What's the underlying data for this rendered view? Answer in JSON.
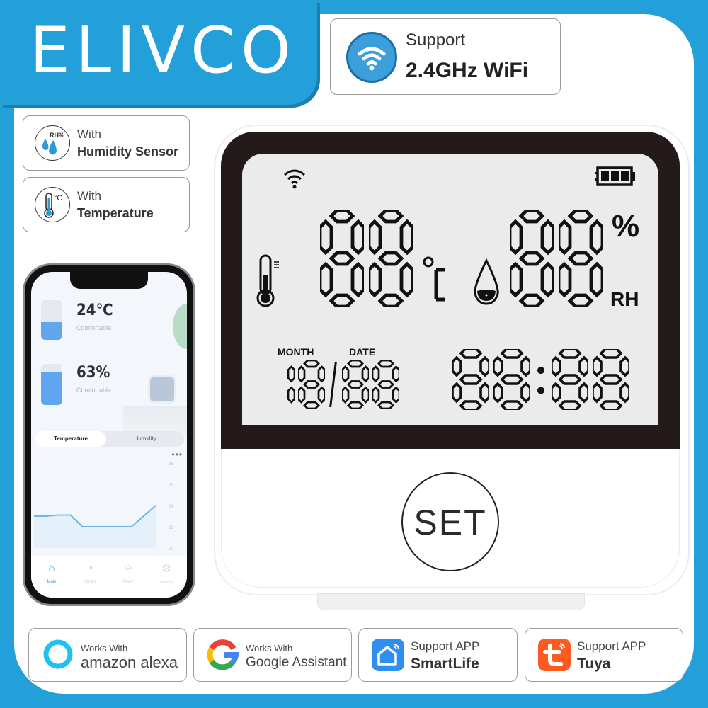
{
  "brand": {
    "logo_text": "ELIVCO",
    "accent_color": "#239fd9"
  },
  "wifi_badge": {
    "line1": "Support",
    "line2": "2.4GHz WiFi",
    "icon": "wifi-icon",
    "icon_color": "#3a9fdb"
  },
  "features": [
    {
      "icon": "humidity-drops-icon",
      "icon_text": "RH%",
      "line1": "With",
      "line2": "Humidity Sensor"
    },
    {
      "icon": "thermometer-icon",
      "icon_text": "℃",
      "line1": "With",
      "line2": "Temperature"
    }
  ],
  "phone_app": {
    "temperature": {
      "value": "24℃",
      "status": "Comfortable",
      "gauge_fill": 0.45
    },
    "humidity": {
      "value": "63%",
      "status": "Comfortable",
      "gauge_fill": 0.8
    },
    "tabs": [
      {
        "label": "Temperature",
        "active": true
      },
      {
        "label": "Humidity",
        "active": false
      }
    ],
    "more_label": "•••",
    "chart_data": {
      "type": "area",
      "title": "",
      "xlabel": "",
      "ylabel": "",
      "y_ticks": [
        "28",
        "26",
        "24",
        "22",
        "20"
      ],
      "ylim": [
        20,
        28
      ],
      "x": [
        0,
        1,
        2,
        3,
        4,
        5,
        6,
        7,
        8,
        9,
        10
      ],
      "values": [
        23.0,
        23.0,
        23.1,
        23.1,
        22.0,
        22.0,
        22.0,
        22.0,
        22.0,
        23.0,
        24.0
      ],
      "grid": false,
      "line_color": "#5ab0e0"
    },
    "nav": [
      {
        "label": "Main",
        "icon": "home-icon",
        "glyph": "⌂",
        "active": true
      },
      {
        "label": "Smart",
        "icon": "clock-icon",
        "glyph": "◔",
        "active": false
      },
      {
        "label": "Alarm",
        "icon": "bell-icon",
        "glyph": "⍾",
        "active": false
      },
      {
        "label": "Setting",
        "icon": "gear-icon",
        "glyph": "⚙",
        "active": false
      }
    ]
  },
  "device": {
    "temperature_digits": "88",
    "temperature_unit": "°C",
    "humidity_digits": "88",
    "humidity_unit_top": "%",
    "humidity_unit_bottom": "RH",
    "month_label": "MONTH",
    "date_label": "DATE",
    "month_digits": "18",
    "date_separator": "/",
    "date_digits": "88",
    "time_hours": "88",
    "time_separator": ":",
    "time_minutes": "88",
    "battery_bars": 3,
    "set_button_label": "SET"
  },
  "badges": [
    {
      "id": "alexa",
      "icon": "alexa-icon",
      "line1": "Works With",
      "line2": "amazon alexa"
    },
    {
      "id": "google",
      "icon": "google-icon",
      "line1": "Works With",
      "line2": "Google Assistant"
    },
    {
      "id": "smartlife",
      "icon": "smartlife-icon",
      "line1": "Support APP",
      "line2": "SmartLife",
      "color": "#2f8ff0"
    },
    {
      "id": "tuya",
      "icon": "tuya-icon",
      "line1": "Support APP",
      "line2": "Tuya",
      "color": "#ff5a1f"
    }
  ]
}
